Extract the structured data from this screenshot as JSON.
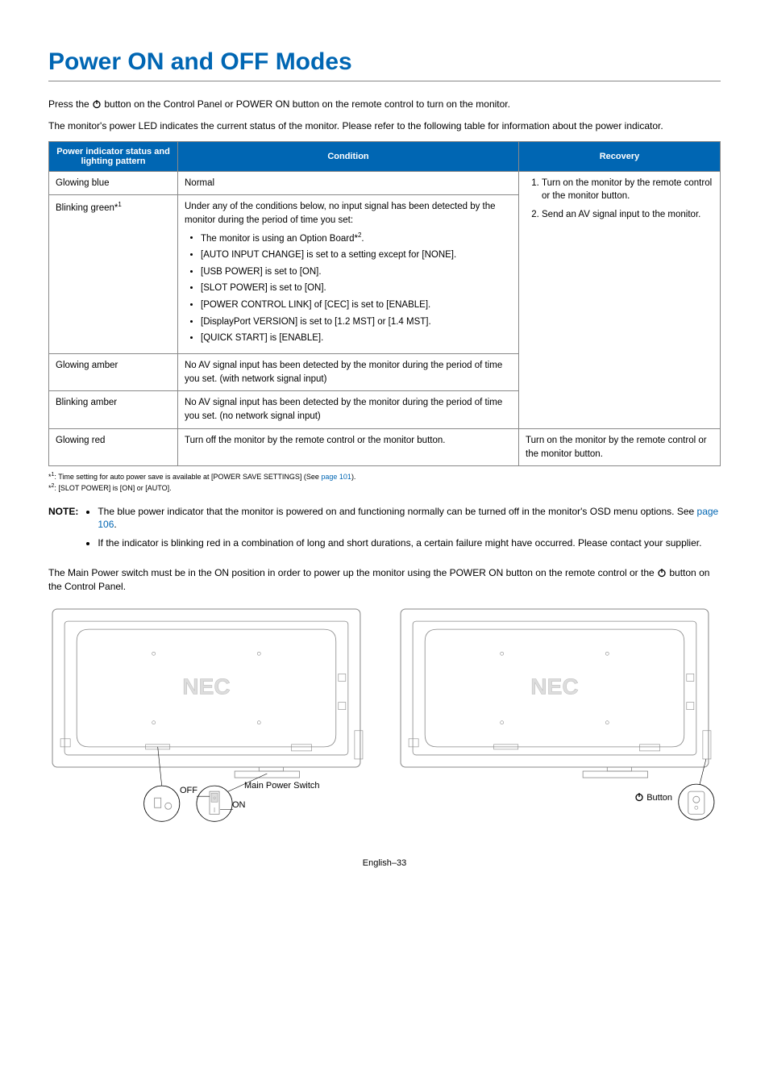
{
  "heading": "Power ON and OFF Modes",
  "intro1_a": "Press the ",
  "intro1_b": " button on the Control Panel or POWER ON button on the remote control to turn on the monitor.",
  "intro2": "The monitor's power LED indicates the current status of the monitor. Please refer to the following table for information about the power indicator.",
  "table": {
    "headers": {
      "c1": "Power indicator status and lighting pattern",
      "c2": "Condition",
      "c3": "Recovery"
    },
    "rows": {
      "r1": {
        "status": "Glowing blue",
        "condition": "Normal"
      },
      "r2": {
        "status_a": "Blinking green*",
        "status_sup": "1",
        "cond_intro": "Under any of the conditions below, no input signal has been detected by the monitor during the period of time you set:",
        "items": [
          {
            "a": "The monitor is using an Option Board*",
            "sup": "2",
            "b": "."
          },
          {
            "a": "[AUTO INPUT CHANGE] is set to a setting except for [NONE]."
          },
          {
            "a": "[USB POWER] is set to [ON]."
          },
          {
            "a": "[SLOT POWER] is set to [ON]."
          },
          {
            "a": "[POWER CONTROL LINK] of [CEC] is set to [ENABLE]."
          },
          {
            "a": "[DisplayPort VERSION] is set to [1.2 MST] or [1.4 MST]."
          },
          {
            "a": "[QUICK START] is [ENABLE]."
          }
        ]
      },
      "r3": {
        "status": "Glowing amber",
        "condition": "No AV signal input has been detected by the monitor during the period of time you set. (with network signal input)"
      },
      "r4": {
        "status": "Blinking amber",
        "condition": "No AV signal input has been detected by the monitor during the period of time you set. (no network signal input)"
      },
      "r5": {
        "status": "Glowing red",
        "condition": "Turn off the monitor by the remote control or the monitor button.",
        "recovery": "Turn on the monitor by the remote control or the monitor button."
      }
    },
    "recovery_top": {
      "i1": "Turn on the monitor by the remote control or the monitor button.",
      "i2": "Send an AV signal input to the monitor."
    }
  },
  "footnotes": {
    "f1_a": "*",
    "f1_sup": "1",
    "f1_b": ": Time setting for auto power save is available at [POWER SAVE SETTINGS] (See ",
    "f1_link": "page 101",
    "f1_c": ").",
    "f2_a": "*",
    "f2_sup": "2",
    "f2_b": ": [SLOT POWER] is [ON] or [AUTO]."
  },
  "note": {
    "label": "NOTE:",
    "n1_a": "The blue power indicator that the monitor is powered on and functioning normally can be turned off in the monitor's OSD menu options. See ",
    "n1_link": "page 106",
    "n1_b": ".",
    "n2": "If the indicator is blinking red in a combination of long and short durations, a certain failure might have occurred. Please contact your supplier."
  },
  "para_after_a": "The Main Power switch must be in the ON position in order to power up the monitor using the POWER ON button on the remote control or the ",
  "para_after_b": " button on the Control Panel.",
  "diagram": {
    "off": "OFF",
    "on": "ON",
    "mps": "Main Power Switch",
    "button": " Button"
  },
  "footer": "English–33"
}
